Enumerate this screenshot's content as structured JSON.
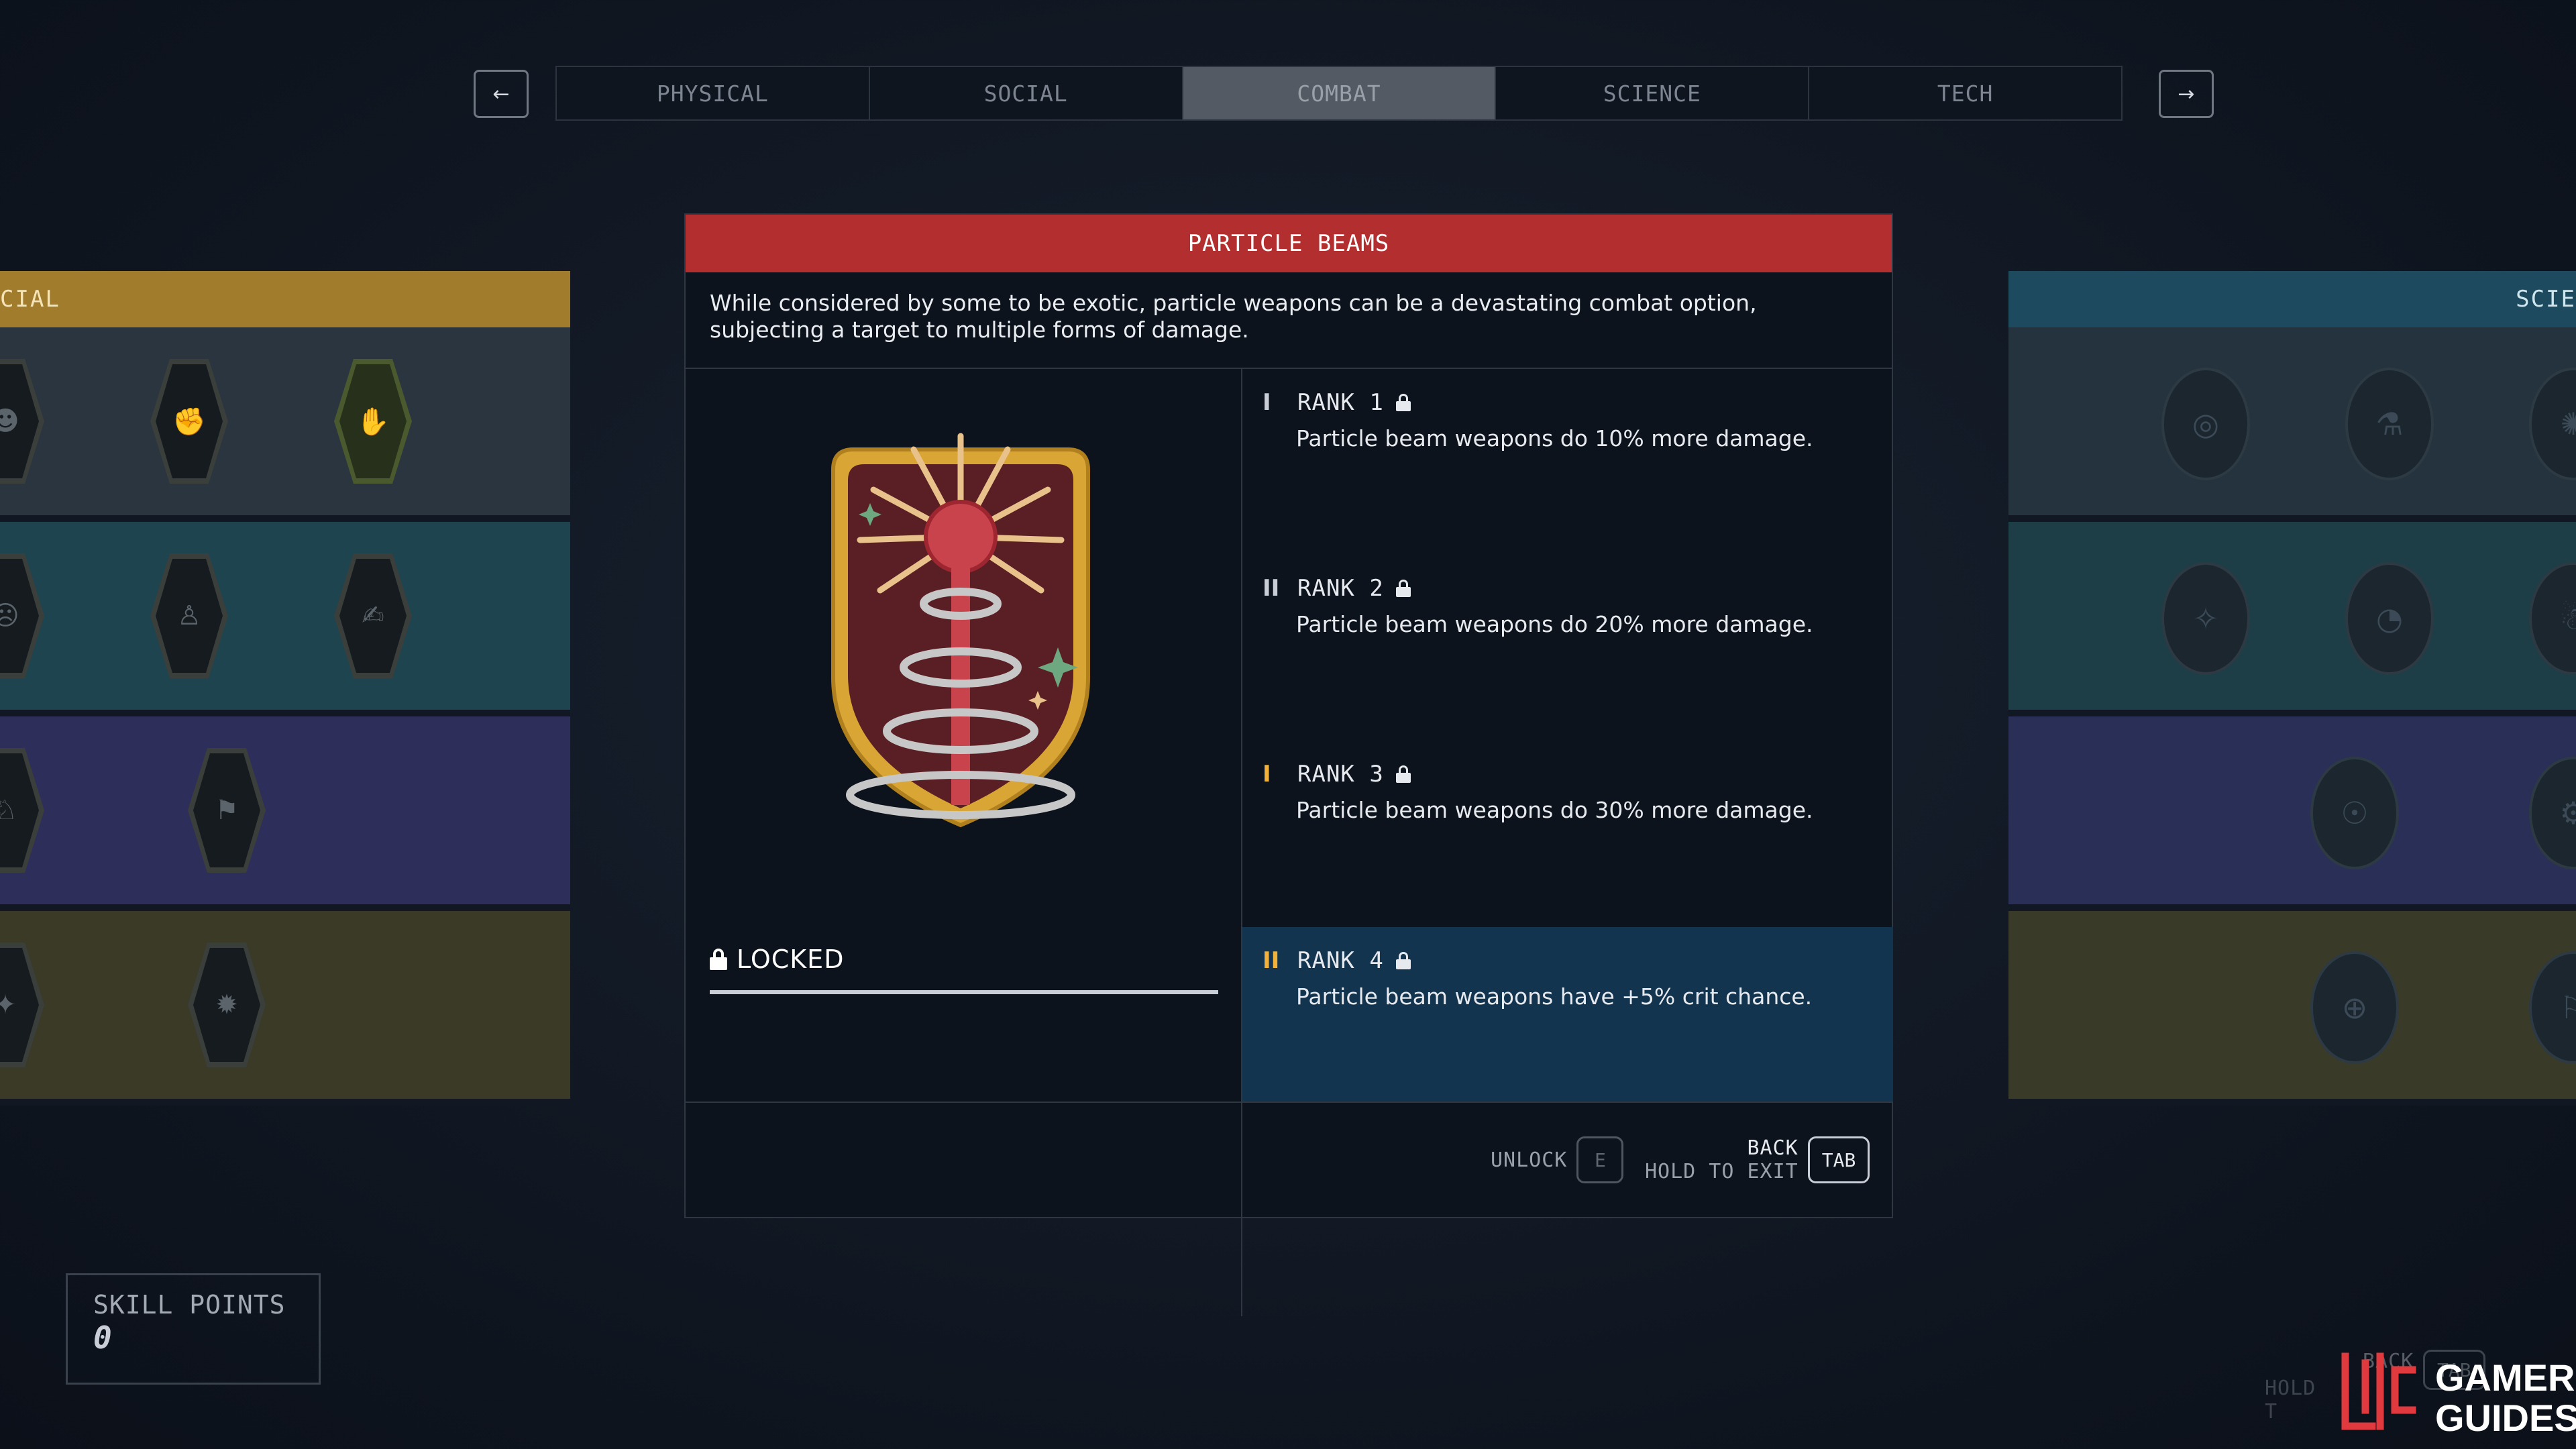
{
  "nav": {
    "prev_icon": "arrow-left-icon",
    "prev_glyph": "←",
    "next_icon": "arrow-right-icon",
    "next_glyph": "→",
    "tabs": [
      {
        "label": "PHYSICAL",
        "active": false
      },
      {
        "label": "SOCIAL",
        "active": false
      },
      {
        "label": "COMBAT",
        "active": true
      },
      {
        "label": "SCIENCE",
        "active": false
      },
      {
        "label": "TECH",
        "active": false
      }
    ]
  },
  "left_panel": {
    "header": "CIAL",
    "header_color": "#a07c2c",
    "row_colors": [
      "#2a3540",
      "#1e4450",
      "#2e2e5a",
      "#3b3a27"
    ]
  },
  "right_panel": {
    "header": "SCIE",
    "header_color": "#1d4a5e",
    "row_colors": [
      "#24333d",
      "#1d3d47",
      "#2a2f57",
      "#393a28"
    ]
  },
  "skill": {
    "title": "PARTICLE BEAMS",
    "title_color": "#b32e2e",
    "description": "While considered by some to be exotic, particle weapons can be a devastating combat option, subjecting a target to multiple forms of damage.",
    "status": "LOCKED",
    "ranks": [
      {
        "pips": "I",
        "label": "RANK 1",
        "desc": "Particle beam weapons do 10% more damage."
      },
      {
        "pips": "II",
        "label": "RANK 2",
        "desc": "Particle beam weapons do 20% more damage."
      },
      {
        "pips": "I",
        "label": "RANK 3",
        "desc": "Particle beam weapons do 30% more damage."
      },
      {
        "pips": "II",
        "label": "RANK 4",
        "desc": "Particle beam weapons have +5% crit chance."
      }
    ]
  },
  "footer": {
    "unlock_label": "UNLOCK",
    "unlock_key": "E",
    "back_label": "BACK",
    "exit_label": "HOLD TO EXIT",
    "back_key": "TAB"
  },
  "skill_points": {
    "label": "SKILL POINTS",
    "value": "0"
  },
  "bg_hint": {
    "back_label": "BACK",
    "hold_label": "HOLD T",
    "key": "TAB"
  },
  "watermark": {
    "line1": "GAMER",
    "line2": "GUIDES"
  }
}
